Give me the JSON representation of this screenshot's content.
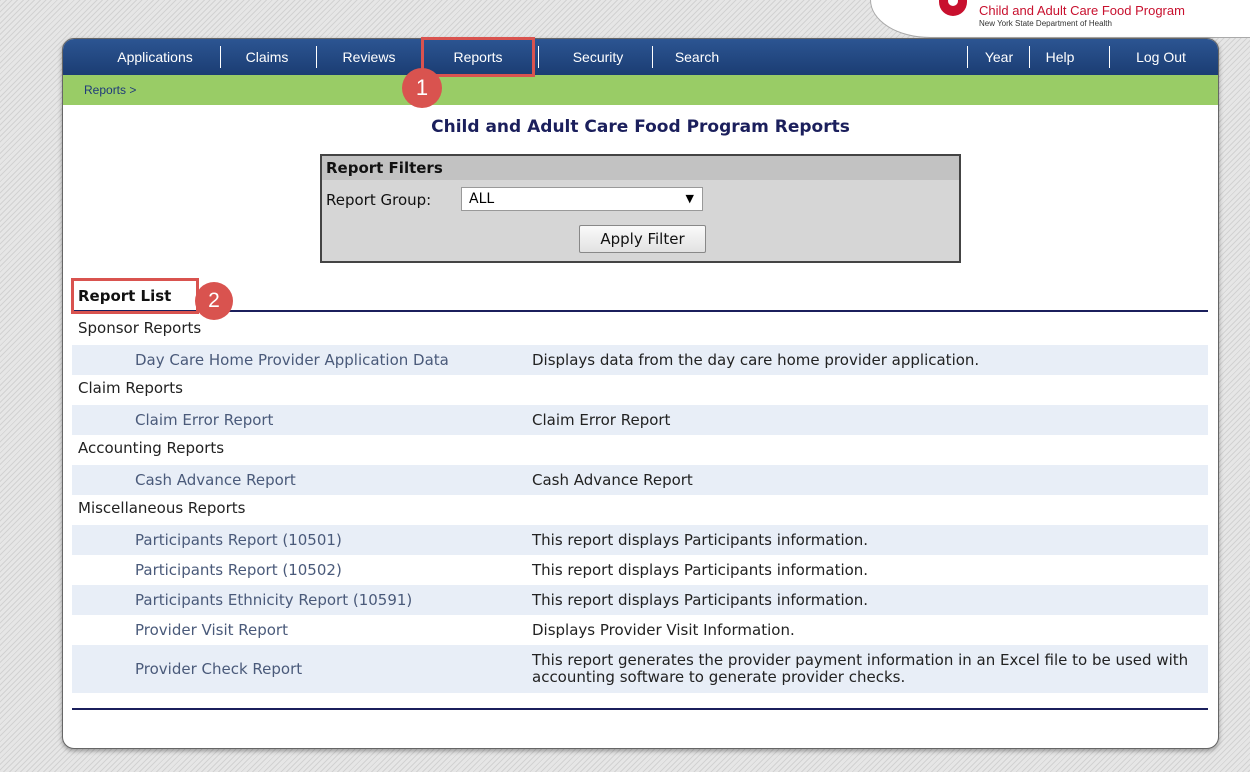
{
  "header": {
    "program_title": "Child and Adult Care Food Program",
    "department": "New York State Department of Health"
  },
  "nav": {
    "items": [
      {
        "label": "Applications"
      },
      {
        "label": "Claims"
      },
      {
        "label": "Reviews"
      },
      {
        "label": "Reports"
      },
      {
        "label": "Security"
      },
      {
        "label": "Search"
      },
      {
        "label": "Year"
      },
      {
        "label": "Help"
      },
      {
        "label": "Log Out"
      }
    ],
    "active": "Reports"
  },
  "breadcrumb": "Reports >",
  "page_title": "Child and Adult Care Food Program Reports",
  "filters": {
    "heading": "Report Filters",
    "group_label": "Report Group:",
    "group_value": "ALL",
    "apply_label": "Apply Filter"
  },
  "report_list": {
    "heading": "Report List",
    "groups": [
      {
        "name": "Sponsor Reports",
        "rows": [
          {
            "name": "Day Care Home Provider Application Data",
            "desc": "Displays data from the day care home provider application."
          }
        ]
      },
      {
        "name": "Claim Reports",
        "rows": [
          {
            "name": "Claim Error Report",
            "desc": "Claim Error Report"
          }
        ]
      },
      {
        "name": "Accounting Reports",
        "rows": [
          {
            "name": "Cash Advance Report",
            "desc": "Cash Advance Report"
          }
        ]
      },
      {
        "name": "Miscellaneous Reports",
        "rows": [
          {
            "name": "Participants Report (10501)",
            "desc": "This report displays Participants information."
          },
          {
            "name": "Participants Report (10502)",
            "desc": "This report displays Participants information."
          },
          {
            "name": "Participants Ethnicity Report (10591)",
            "desc": "This report displays Participants information."
          },
          {
            "name": "Provider Visit Report",
            "desc": "Displays Provider Visit Information."
          },
          {
            "name": "Provider Check Report",
            "desc": "This report generates the provider payment information in an Excel file to be used with accounting software to generate provider checks."
          }
        ]
      }
    ]
  },
  "annotations": [
    {
      "number": "1"
    },
    {
      "number": "2"
    }
  ],
  "colors": {
    "nav": "#1e4178",
    "breadcrumb_bar": "#99cc66",
    "annotation": "#d9534f",
    "row_shade": "#e8eef7"
  }
}
